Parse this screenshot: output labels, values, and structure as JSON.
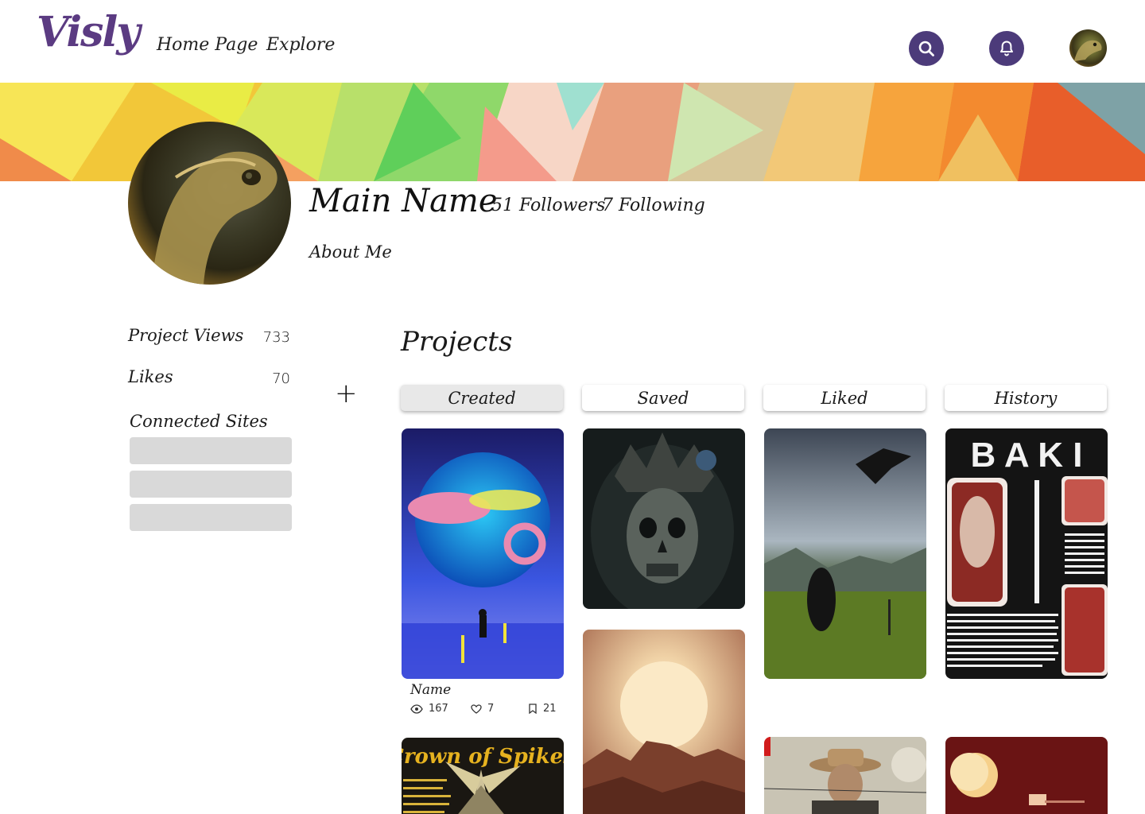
{
  "app": {
    "logo": "Visly",
    "nav": {
      "home": "Home Page",
      "explore": "Explore"
    },
    "icons": {
      "search": "search-icon",
      "notifications": "bell-icon"
    },
    "accent_color": "#4c3b7a"
  },
  "profile": {
    "name": "Main Name",
    "followers": "51 Followers",
    "following": "7 Following",
    "about": "About Me"
  },
  "stats": [
    {
      "label": "Project Views",
      "value": "733"
    },
    {
      "label": "Likes",
      "value": "70"
    }
  ],
  "connected_sites": {
    "label": "Connected Sites",
    "slots": 3
  },
  "add_symbol": "+",
  "projects": {
    "title": "Projects",
    "tabs": [
      "Created",
      "Saved",
      "Liked",
      "History"
    ],
    "active_tab": "Created",
    "featured": {
      "name": "Name",
      "views": "167",
      "likes": "7",
      "saves": "21"
    },
    "poster_texts": {
      "baki_title": "B A K I",
      "crown_title": "Crown of Spikes"
    }
  }
}
